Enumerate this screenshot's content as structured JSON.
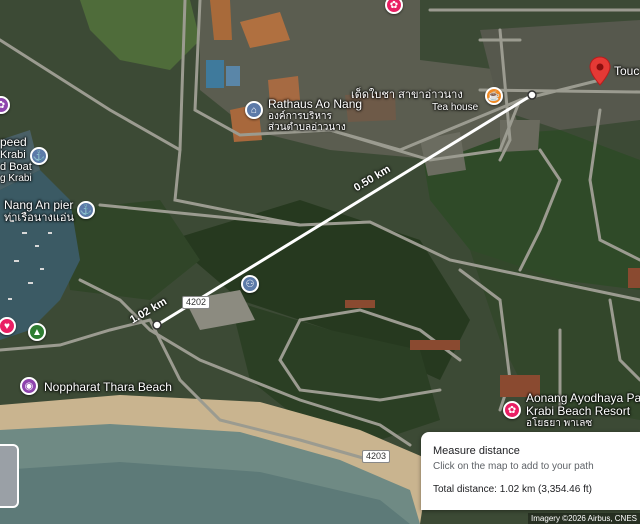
{
  "map": {
    "labels": {
      "touch": "Touc",
      "rathaus": "Rathaus Ao Nang",
      "rathaus_thai_1": "องค์การบริหาร",
      "rathaus_thai_2": "ส่วนตำบลอ่าวนาง",
      "teahouse_thai": "เด็ดใบชา สาขาอ่าวนาง",
      "teahouse": "Tea house",
      "speed_1": "peed",
      "speed_2": "Krabi",
      "speed_3": "d Boat",
      "speed_4": "g Krabi",
      "pier": "Nang An pier",
      "pier_thai": "ท่าเรือนางแอ่น",
      "beach": "Noppharat Thara Beach",
      "resort_1": "Aonang Ayodhaya Pal",
      "resort_2": "Krabi Beach Resort",
      "resort_thai": "อโยธยา พาเลซ",
      "road_4202": "4202",
      "road_4203": "4203"
    },
    "measure_labels": {
      "segment": "0.50 km",
      "total": "1.02 km"
    },
    "icons": {
      "pin": "red-location-pin",
      "rathaus": "government-building-icon",
      "teahouse": "cafe-cup-icon",
      "pier": "ferry-terminal-icon",
      "restroom": "restroom-icon",
      "beach": "camera-icon",
      "resort": "hotel-icon"
    }
  },
  "measure_panel": {
    "title": "Measure distance",
    "subtitle": "Click on the map to add to your path",
    "total": "Total distance: 1.02 km (3,354.46 ft)"
  },
  "attribution": "Imagery ©2026 Airbus, CNES",
  "colors": {
    "measure_line": "#ffffff",
    "pin": "#e53935",
    "poi_blue": "#5c7aa8",
    "poi_purple": "#8e44ad",
    "poi_orange": "#f08a24",
    "poi_pink": "#e91e63",
    "poi_green": "#2e7d32"
  }
}
